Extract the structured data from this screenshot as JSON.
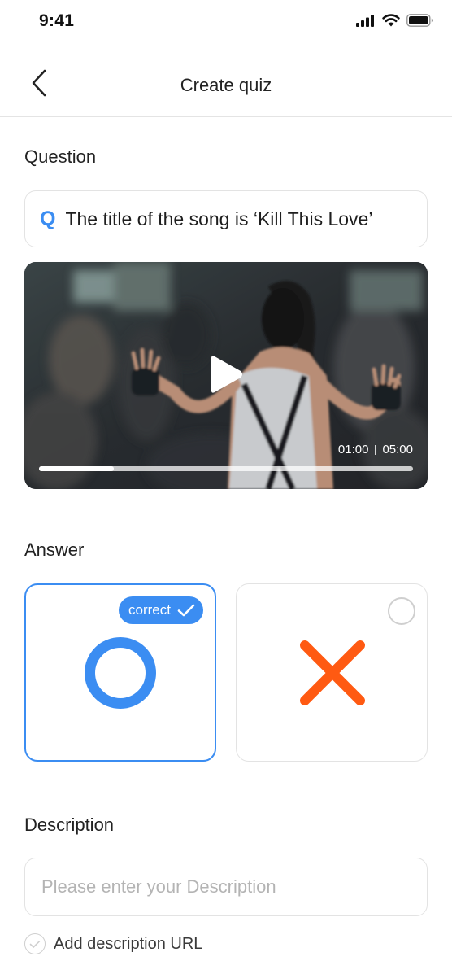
{
  "status_bar": {
    "time": "9:41"
  },
  "nav": {
    "title": "Create quiz"
  },
  "question": {
    "label": "Question",
    "icon_letter": "Q",
    "text": "The title of the song is ‘Kill This Love’"
  },
  "video": {
    "current_time": "01:00",
    "total_time": "05:00",
    "progress_fraction": 0.2
  },
  "answer": {
    "label": "Answer",
    "options": [
      {
        "symbol": "O",
        "selected": true,
        "badge": "correct"
      },
      {
        "symbol": "X",
        "selected": false
      }
    ]
  },
  "description": {
    "label": "Description",
    "placeholder": "Please enter your Description",
    "value": ""
  },
  "add_url": {
    "label": "Add description URL",
    "checked": false
  },
  "colors": {
    "accent": "#3b8df2",
    "x_mark": "#ff5a12",
    "border": "#e3e3e3"
  }
}
